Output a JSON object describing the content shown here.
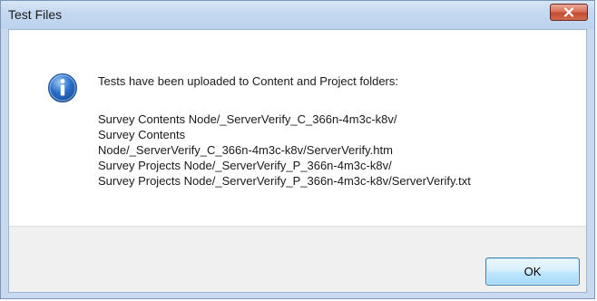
{
  "window": {
    "title": "Test Files"
  },
  "dialog": {
    "icon": "information-icon",
    "message": "Tests have been uploaded to Content and Project folders:",
    "paths": [
      "Survey Contents Node/_ServerVerify_C_366n-4m3c-k8v/",
      "Survey Contents",
      "Node/_ServerVerify_C_366n-4m3c-k8v/ServerVerify.htm",
      "Survey Projects Node/_ServerVerify_P_366n-4m3c-k8v/",
      "Survey Projects Node/_ServerVerify_P_366n-4m3c-k8v/ServerVerify.txt"
    ]
  },
  "buttons": {
    "ok_label": "OK",
    "close_icon": "close-icon"
  },
  "colors": {
    "titlebar": "#c5d8f0",
    "close_button": "#c24c32",
    "info_icon": "#2a6fc9",
    "footer": "#f0f0f0",
    "ok_border": "#3c7fb1"
  }
}
